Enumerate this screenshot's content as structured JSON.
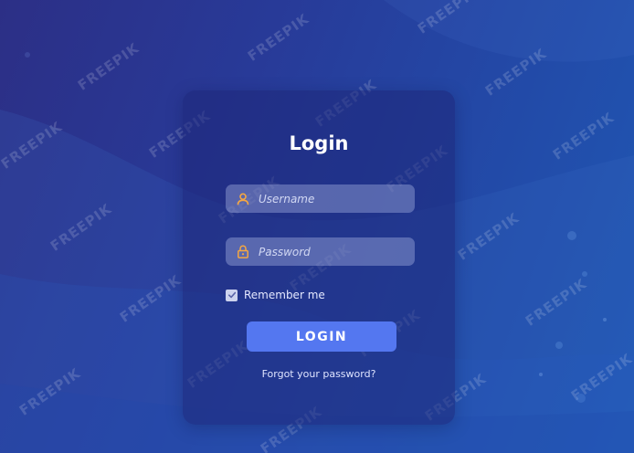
{
  "login": {
    "title": "Login",
    "username": {
      "placeholder": "Username",
      "icon": "user-icon"
    },
    "password": {
      "placeholder": "Password",
      "icon": "lock-icon"
    },
    "remember": {
      "label": "Remember me",
      "checked": true
    },
    "button_label": "LOGIN",
    "forgot_link": "Forgot your password?"
  },
  "colors": {
    "accent": "#5477f0",
    "icon": "#f5a742"
  }
}
